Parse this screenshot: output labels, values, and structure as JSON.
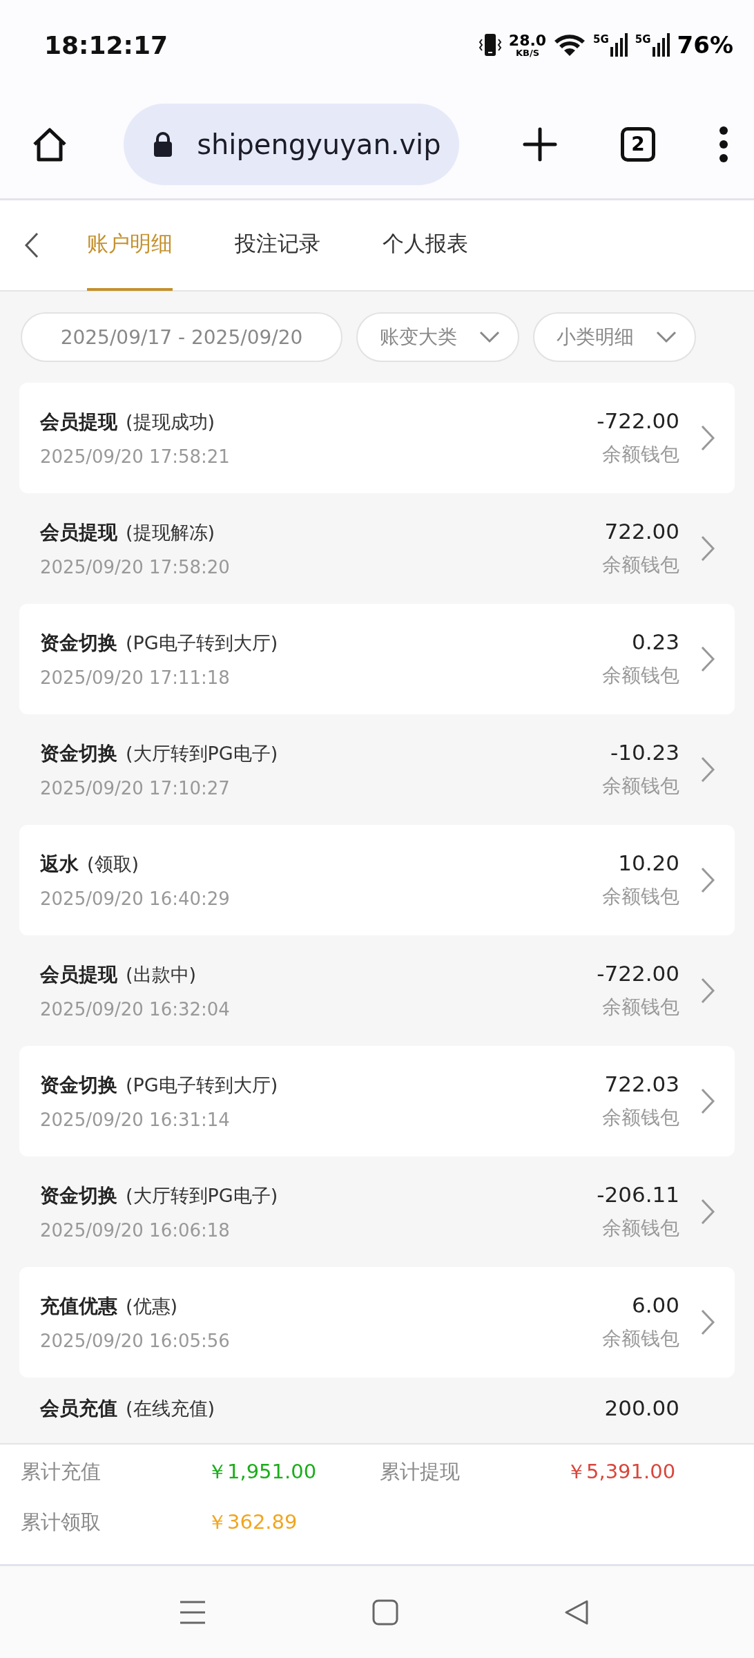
{
  "status_bar": {
    "time": "18:12:17",
    "speed": "28.0",
    "speed_unit": "KB/S",
    "sim1": "5G",
    "sim2": "5G",
    "battery": "76%"
  },
  "browser": {
    "url": "shipengyuyan.vip",
    "tab_count": "2"
  },
  "tabs": [
    {
      "label": "账户明细",
      "selected": true
    },
    {
      "label": "投注记录",
      "selected": false
    },
    {
      "label": "个人报表",
      "selected": false
    }
  ],
  "filters": {
    "date_range": "2025/09/17 - 2025/09/20",
    "category": "账变大类",
    "subcategory": "小类明细"
  },
  "records": [
    {
      "title": "会员提现",
      "detail": "(提现成功)",
      "time": "2025/09/20 17:58:21",
      "amount": "-722.00",
      "wallet": "余额钱包"
    },
    {
      "title": "会员提现",
      "detail": "(提现解冻)",
      "time": "2025/09/20 17:58:20",
      "amount": "722.00",
      "wallet": "余额钱包"
    },
    {
      "title": "资金切换",
      "detail": "(PG电子转到大厅)",
      "time": "2025/09/20 17:11:18",
      "amount": "0.23",
      "wallet": "余额钱包"
    },
    {
      "title": "资金切换",
      "detail": "(大厅转到PG电子)",
      "time": "2025/09/20 17:10:27",
      "amount": "-10.23",
      "wallet": "余额钱包"
    },
    {
      "title": "返水",
      "detail": "(领取)",
      "time": "2025/09/20 16:40:29",
      "amount": "10.20",
      "wallet": "余额钱包"
    },
    {
      "title": "会员提现",
      "detail": "(出款中)",
      "time": "2025/09/20 16:32:04",
      "amount": "-722.00",
      "wallet": "余额钱包"
    },
    {
      "title": "资金切换",
      "detail": "(PG电子转到大厅)",
      "time": "2025/09/20 16:31:14",
      "amount": "722.03",
      "wallet": "余额钱包"
    },
    {
      "title": "资金切换",
      "detail": "(大厅转到PG电子)",
      "time": "2025/09/20 16:06:18",
      "amount": "-206.11",
      "wallet": "余额钱包"
    },
    {
      "title": "充值优惠",
      "detail": "(优惠)",
      "time": "2025/09/20 16:05:56",
      "amount": "6.00",
      "wallet": "余额钱包"
    },
    {
      "title": "会员充值",
      "detail": "(在线充值)",
      "amount": "200.00"
    }
  ],
  "summary": [
    {
      "label": "累计充值",
      "value": "￥1,951.00",
      "color": "#1aad19"
    },
    {
      "label": "累计提现",
      "value": "￥5,391.00",
      "color": "#d9463c"
    },
    {
      "label": "累计领取",
      "value": "￥362.89",
      "color": "#f0a622"
    }
  ]
}
